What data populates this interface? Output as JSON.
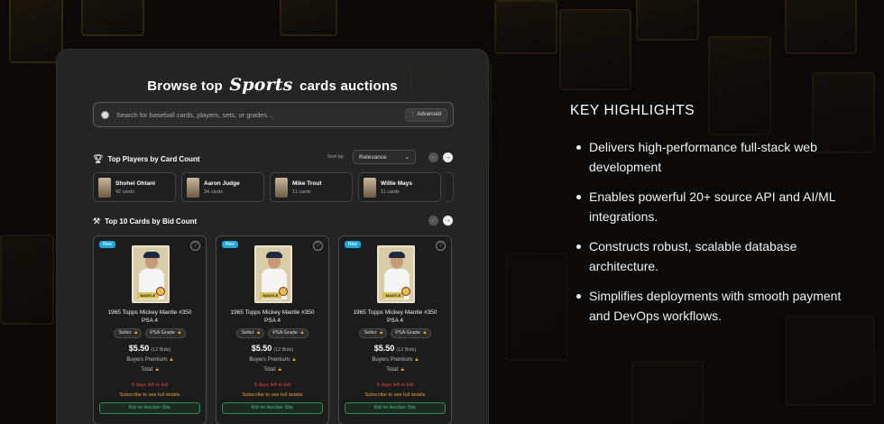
{
  "headline": {
    "pre": "Browse top",
    "script": "Sports",
    "post": "cards auctions"
  },
  "search": {
    "placeholder": "Search for baseball cards, players, sets, or grades...",
    "advanced_label": "Advanced"
  },
  "top_players": {
    "title": "Top Players by Card Count",
    "sort_label": "Sort by:",
    "sort_value": "Relevance",
    "players": [
      {
        "name": "Shohei Ohtani",
        "count": "42 cards"
      },
      {
        "name": "Aaron Judge",
        "count": "34 cards"
      },
      {
        "name": "Mike Trout",
        "count": "11 cards"
      },
      {
        "name": "Willie Mays",
        "count": "11 cards"
      }
    ]
  },
  "top_cards": {
    "title": "Top 10 Cards by Bid Count",
    "cards": [
      {
        "badge": "New",
        "title_line1": "1965 Topps Mickey Mantle #350",
        "title_line2": "PSA 4",
        "chip1": "Seller",
        "chip2": "PSA Grade",
        "price": "$5.50",
        "bids": "(12 Bids)",
        "buyers_premium": "Buyers Premium:",
        "total": "Total:",
        "days_left": "6 days left to bid",
        "subscribe": "Subscribe to see full details",
        "bid_button": "Bid on Auction Site",
        "card_text": "MANTLE"
      },
      {
        "badge": "New",
        "title_line1": "1965 Topps Mickey Mantle #350",
        "title_line2": "PSA 4",
        "chip1": "Seller",
        "chip2": "PSA Grade",
        "price": "$5.50",
        "bids": "(12 Bids)",
        "buyers_premium": "Buyers Premium:",
        "total": "Total:",
        "days_left": "6 days left to bid",
        "subscribe": "Subscribe to see full details",
        "bid_button": "Bid on Auction Site",
        "card_text": "MANTLE"
      },
      {
        "badge": "New",
        "title_line1": "1965 Topps Mickey Mantle #350",
        "title_line2": "PSA 4",
        "chip1": "Seller",
        "chip2": "PSA Grade",
        "price": "$5.50",
        "bids": "(12 Bids)",
        "buyers_premium": "Buyers Premium:",
        "total": "Total:",
        "days_left": "6 days left to bid",
        "subscribe": "Subscribe to see full details",
        "bid_button": "Bid on Auction Site",
        "card_text": "MANTLE"
      }
    ]
  },
  "highlights": {
    "title": "KEY HIGHLIGHTS",
    "items": [
      "Delivers high-performance full-stack web development",
      "Enables powerful 20+ source API and AI/ML integrations.",
      "Constructs robust, scalable database architecture.",
      "Simplifies deployments with smooth payment and DevOps workflows."
    ]
  },
  "colors": {
    "new_badge": "#1fa8d8",
    "days_left": "#e04848",
    "subscribe": "#e4a23a",
    "bid_button": "#45c27a",
    "lock": "#d9a531"
  },
  "icons": {
    "search": "baseball-icon",
    "advanced": "sliders-icon",
    "players_section": "trophy-icon",
    "cards_section": "hammer-icon",
    "favorite": "heart-icon",
    "locked": "lock-icon"
  }
}
